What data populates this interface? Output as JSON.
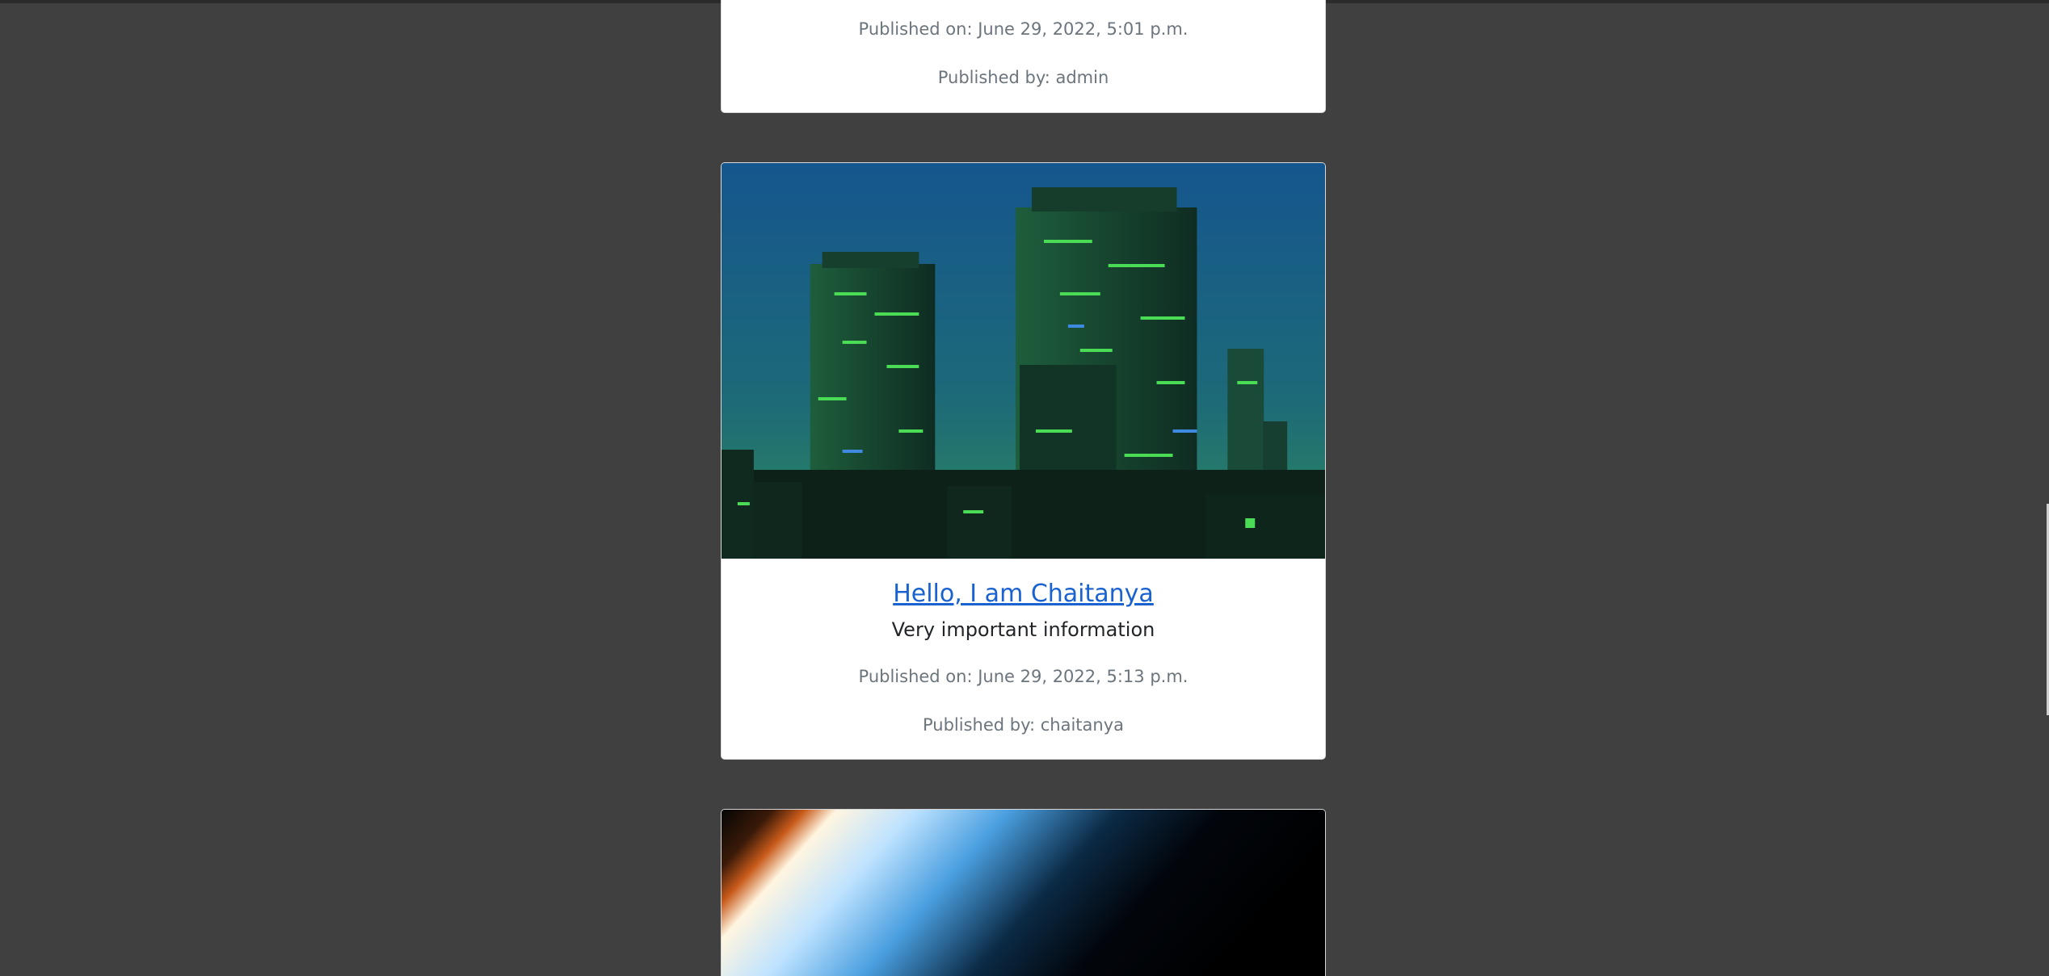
{
  "posts": [
    {
      "published_on": "Published on: June 29, 2022, 5:01 p.m.",
      "published_by": "Published by: admin"
    },
    {
      "title": "Hello, I am Chaitanya",
      "description": "Very important information",
      "published_on": "Published on: June 29, 2022, 5:13 p.m.",
      "published_by": "Published by: chaitanya"
    },
    {}
  ]
}
